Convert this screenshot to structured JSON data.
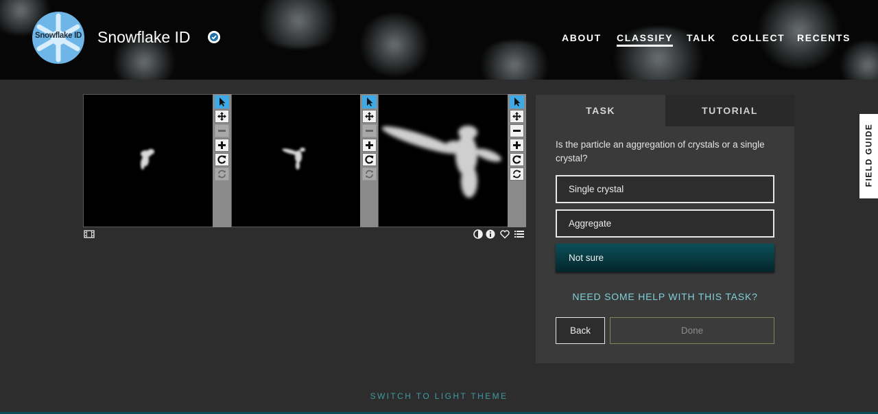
{
  "header": {
    "avatar_text": "Snowflake ID",
    "project_title": "Snowflake ID",
    "nav": [
      {
        "label": "ABOUT",
        "active": false
      },
      {
        "label": "CLASSIFY",
        "active": true
      },
      {
        "label": "TALK",
        "active": false
      },
      {
        "label": "COLLECT",
        "active": false
      },
      {
        "label": "RECENTS",
        "active": false
      }
    ]
  },
  "viewer": {
    "frames": 3,
    "toolbar_icons": [
      "pointer-icon",
      "move-icon",
      "zoom-out-icon",
      "zoom-in-icon",
      "rotate-icon",
      "reset-icon"
    ],
    "footer_icons": [
      "film-icon",
      "invert-icon",
      "info-icon",
      "favorite-icon",
      "collect-icon"
    ]
  },
  "task": {
    "tabs": [
      {
        "label": "TASK",
        "active": true
      },
      {
        "label": "TUTORIAL",
        "active": false
      }
    ],
    "question": "Is the particle an aggregation of crystals or a single crystal?",
    "answers": [
      {
        "label": "Single crystal",
        "selected": false
      },
      {
        "label": "Aggregate",
        "selected": false
      },
      {
        "label": "Not sure",
        "selected": true
      }
    ],
    "help_link": "NEED SOME HELP WITH THIS TASK?",
    "back_label": "Back",
    "done_label": "Done"
  },
  "field_guide_label": "FIELD GUIDE",
  "theme_switch_label": "SWITCH TO LIGHT THEME",
  "colors": {
    "accent": "#3fa9e6",
    "selected_answer": "#0b4e58",
    "link": "#7fd1d8"
  }
}
